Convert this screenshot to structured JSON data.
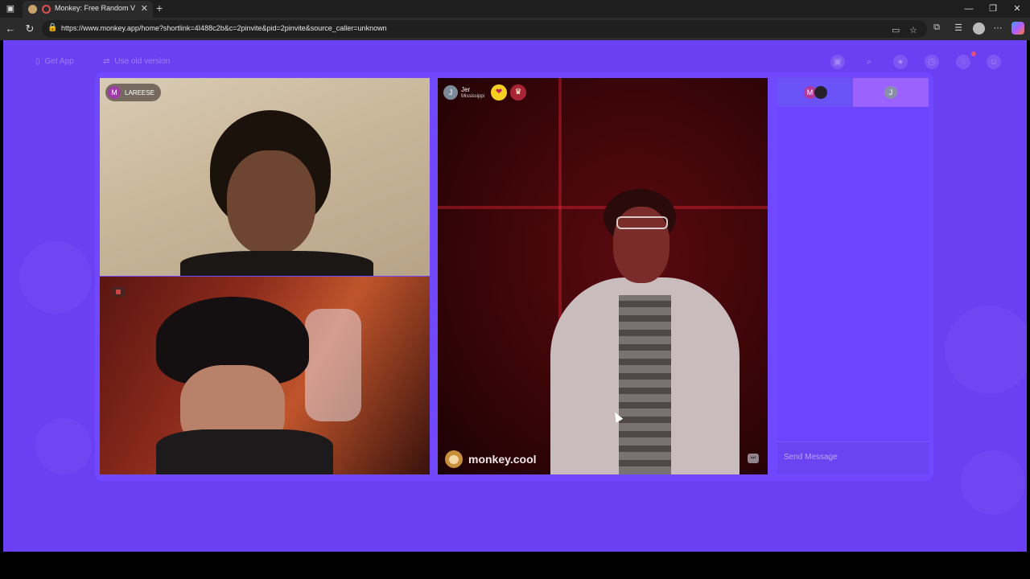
{
  "browser": {
    "tab_title": "Monkey: Free Random Video",
    "url": "https://www.monkey.app/home?shortlink=4I488c2b&c=2pinvite&pid=2pinvite&source_caller=unknown"
  },
  "topnav": {
    "get_app_label": "Get App",
    "old_version_label": "Use old version"
  },
  "video_chat": {
    "participant_1": {
      "initial": "M",
      "name": "LAREESE"
    },
    "participant_3": {
      "initial": "J",
      "name": "Jer",
      "location": "Mississippi"
    },
    "watermark": "monkey.cool"
  },
  "chat_panel": {
    "tab_1_initial": "M",
    "tab_2_initial": "J",
    "message_placeholder": "Send Message"
  },
  "colors": {
    "page_bg": "#6b3ff2",
    "stage_bg": "#7048ff",
    "chat_tab_active": "#9b62ff"
  },
  "icons": [
    "phone-icon",
    "swap-icon",
    "store-icon",
    "search-icon",
    "avatar-icon",
    "history-icon",
    "chat-bubble-icon",
    "monkey-face-icon",
    "heart-badge-icon",
    "medal-badge-icon",
    "skip-icon",
    "lock-icon"
  ]
}
